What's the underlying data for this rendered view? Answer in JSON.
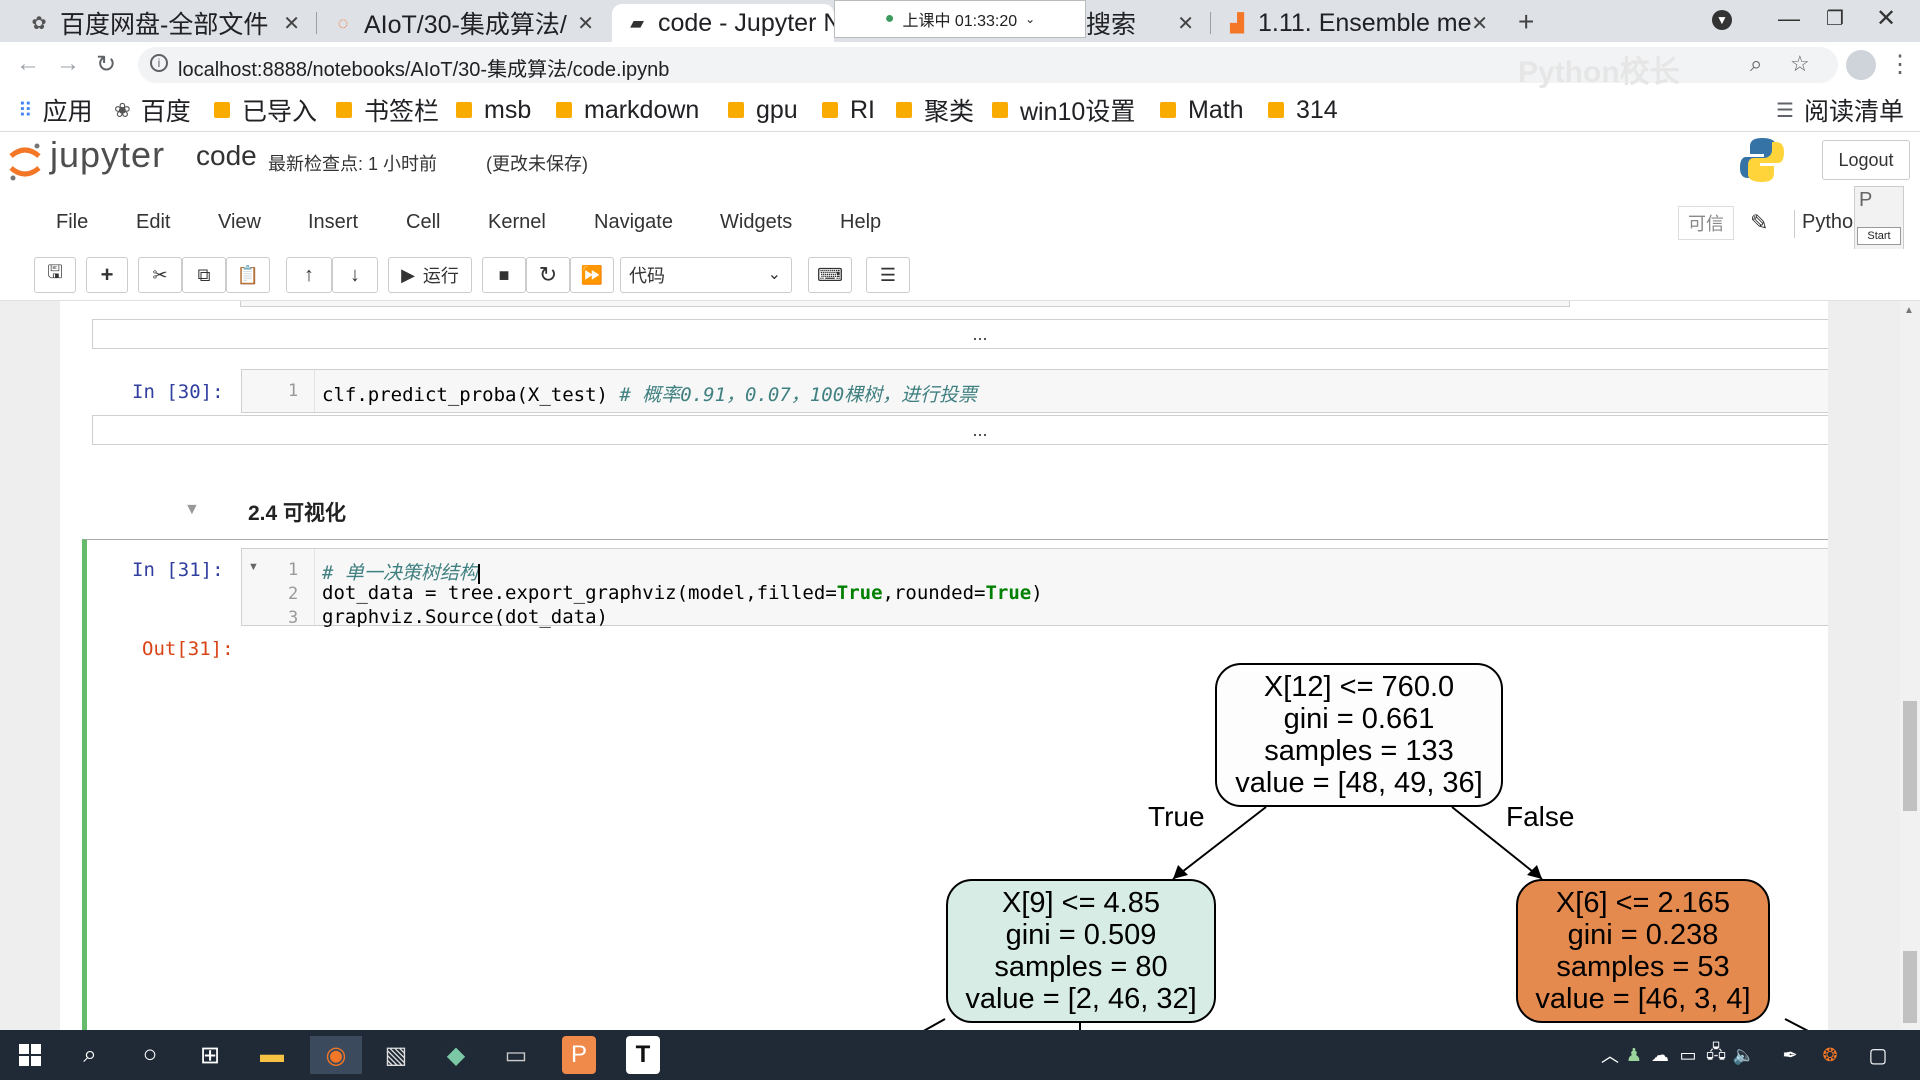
{
  "browser": {
    "tabs": [
      {
        "title": "百度网盘-全部文件"
      },
      {
        "title": "AIoT/30-集成算法/"
      },
      {
        "title": "code - Jupyter N"
      },
      {
        "title": "搜索"
      },
      {
        "title": "1.11. Ensemble me"
      }
    ],
    "recording_badge": "上课中 01:33:20",
    "new_tab_label": "+",
    "url": "localhost:8888/notebooks/AIoT/30-集成算法/code.ipynb",
    "watermark": "Python校长",
    "bookmarks": [
      "应用",
      "百度",
      "已导入",
      "书签栏",
      "msb",
      "markdown",
      "gpu",
      "RI",
      "聚类",
      "win10设置",
      "Math",
      "314"
    ],
    "reading_list": "阅读清单"
  },
  "jupyter": {
    "logo_text": "jupyter",
    "notebook_name": "code",
    "checkpoint": "最新检查点: 1 小时前",
    "unsaved": "(更改未保存)",
    "logout": "Logout",
    "menus": [
      "File",
      "Edit",
      "View",
      "Insert",
      "Cell",
      "Kernel",
      "Navigate",
      "Widgets",
      "Help"
    ],
    "trusted": "可信",
    "kernel": "Pytho",
    "run_label": "运行",
    "cell_type": "代码",
    "overlay_letter": "P",
    "overlay_start": "Start"
  },
  "cells": {
    "collapsed_output": "...",
    "cell30": {
      "prompt": "In  [30]:",
      "line_no": "1",
      "code": "clf.predict_proba(X_test) ",
      "comment": "# 概率0.91，0.07，100棵树，进行投票"
    },
    "heading": "2.4  可视化",
    "cell31": {
      "prompt": "In  [31]:",
      "line_nos": [
        "1",
        "2",
        "3"
      ],
      "line1_comment": "# 单一决策树结构",
      "line2_a": "dot_data = tree.export_graphviz(model,filled=",
      "line2_true1": "True",
      "line2_b": ",rounded=",
      "line2_true2": "True",
      "line2_c": ")",
      "line3": "graphviz.Source(dot_data)"
    },
    "out31_prompt": "Out[31]:"
  },
  "tree": {
    "root": {
      "lines": [
        "X[12] <= 760.0",
        "gini = 0.661",
        "samples = 133",
        "value = [48, 49, 36]"
      ],
      "fill": "#fdfdfd"
    },
    "left": {
      "lines": [
        "X[9] <= 4.85",
        "gini = 0.509",
        "samples = 80",
        "value = [2, 46, 32]"
      ],
      "fill": "#d7ece5"
    },
    "right": {
      "lines": [
        "X[6] <= 2.165",
        "gini = 0.238",
        "samples = 53",
        "value = [46, 3, 4]"
      ],
      "fill": "#e58a4e"
    },
    "edge_true": "True",
    "edge_false": "False"
  },
  "colors": {
    "jupyter_orange": "#f37726",
    "prompt_in": "#303f9f",
    "prompt_out": "#d84315",
    "comment": "#408080",
    "keyword": "#008000",
    "selected_cell": "#66bb6a"
  }
}
